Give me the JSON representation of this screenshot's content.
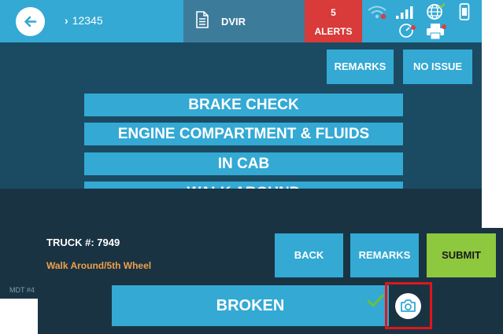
{
  "header": {
    "breadcrumb": "12345",
    "dvir_label": "DVIR",
    "alerts_count": "5",
    "alerts_label": "ALERTS"
  },
  "icons": [
    "back-arrow-icon",
    "chevron-right-icon",
    "document-icon",
    "wifi-icon",
    "signal-icon",
    "globe-icon",
    "phone-icon",
    "tablet-icon",
    "printer-icon",
    "checkmark-icon",
    "camera-icon"
  ],
  "toolbar": {
    "remarks_label": "REMARKS",
    "no_issue_label": "NO ISSUE"
  },
  "categories": [
    "BRAKE CHECK",
    "ENGINE COMPARTMENT & FLUIDS",
    "IN CAB",
    "WALK AROUND"
  ],
  "footer": {
    "mdt_label": "MDT #4"
  },
  "detail": {
    "truck_label": "TRUCK #: 7949",
    "item_label": "Walk Around/5th Wheel",
    "back_label": "BACK",
    "remarks_label": "REMARKS",
    "submit_label": "SUBMIT",
    "status_label": "BROKEN"
  },
  "colors": {
    "accent": "#33a9d4",
    "alert": "#d93a3a",
    "submit": "#8dc83f",
    "highlight_box": "#e0161b",
    "item_text": "#f0a04b"
  }
}
